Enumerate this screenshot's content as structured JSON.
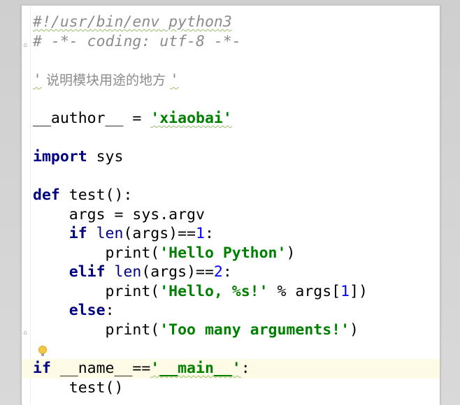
{
  "editor": {
    "language": "python",
    "lines": {
      "shebang": "#!/usr/bin/env python3",
      "coding": "# -*- coding: utf-8 -*-",
      "docstring_open": "'",
      "docstring_text": " 说明模块用途的地方 ",
      "docstring_close": "'",
      "author_name": "__author__",
      "author_eq": " = ",
      "author_value": "'xiaobai'",
      "import_kw": "import",
      "import_mod": " sys",
      "def_kw": "def",
      "def_sig": " test():",
      "args_assign": "    args = sys.argv",
      "if_kw": "    if",
      "if_len": " len",
      "if_args": "(args)==",
      "if_num": "1",
      "if_colon": ":",
      "print1_call": "        print(",
      "print1_str": "'Hello Python'",
      "print1_end": ")",
      "elif_kw": "    elif",
      "elif_len": " len",
      "elif_args": "(args)==",
      "elif_num": "2",
      "elif_colon": ":",
      "print2_call": "        print(",
      "print2_str": "'Hello, %s!'",
      "print2_mid": " % args[",
      "print2_num": "1",
      "print2_end": "])",
      "else_kw": "    else",
      "else_colon": ":",
      "print3_call": "        print(",
      "print3_str": "'Too many arguments!'",
      "print3_end": ")",
      "main_if_kw": "if",
      "main_name": " __name__",
      "main_eq": "==",
      "main_str": "'__main__'",
      "main_colon": ":",
      "call_test": "    test()"
    }
  },
  "colors": {
    "keyword": "#000080",
    "string": "#008000",
    "number": "#0000ff",
    "comment": "#8c8c8c",
    "current_line": "#fdfbe6"
  },
  "icons": [
    "intention-bulb-icon",
    "fold-marker-icon"
  ]
}
